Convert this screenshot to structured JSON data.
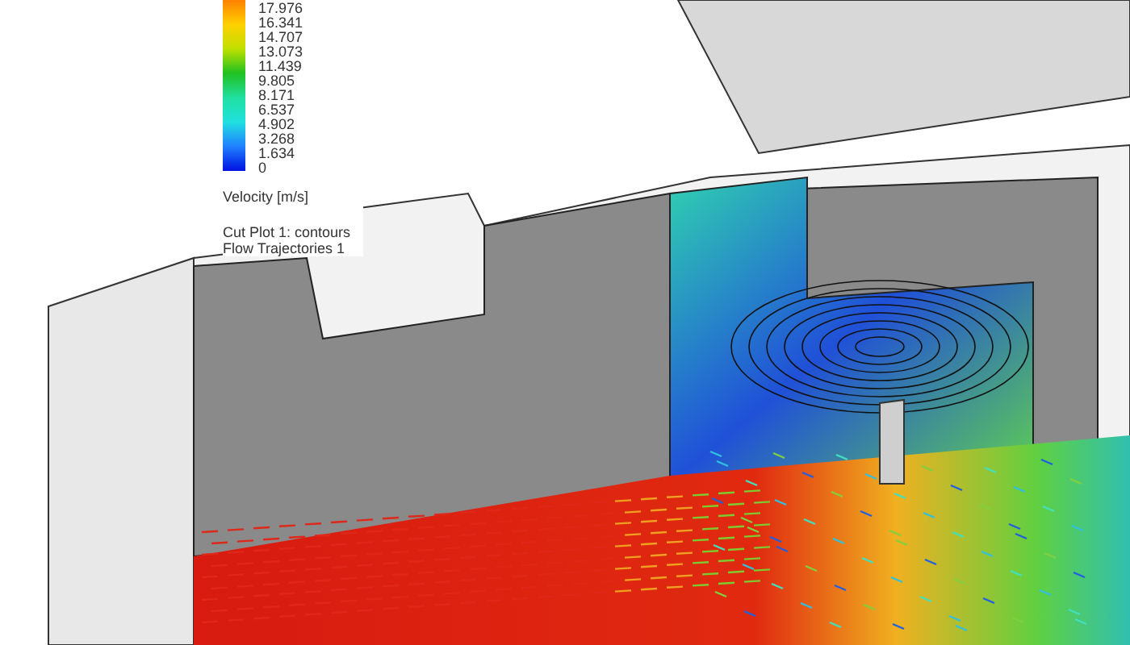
{
  "legend": {
    "ticks": [
      "17.976",
      "16.341",
      "14.707",
      "13.073",
      "11.439",
      "9.805",
      "8.171",
      "6.537",
      "4.902",
      "3.268",
      "1.634",
      "0"
    ],
    "title": "Velocity [m/s]"
  },
  "captions": [
    "Cut Plot 1: contours",
    "Flow Trajectories 1"
  ]
}
